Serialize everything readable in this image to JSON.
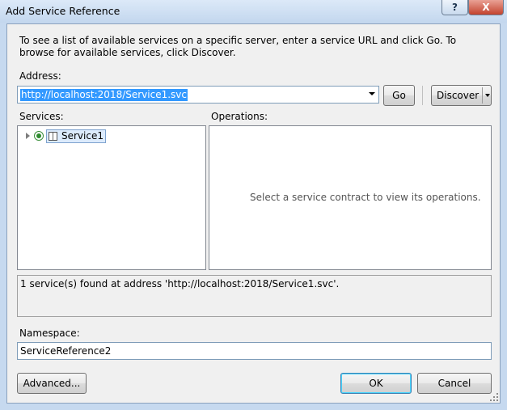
{
  "window": {
    "title": "Add Service Reference",
    "help_glyph": "?",
    "close_glyph": "X"
  },
  "instructions": "To see a list of available services on a specific server, enter a service URL and click Go. To browse for available services, click Discover.",
  "address": {
    "label": "Address:",
    "value": "http://localhost:2018/Service1.svc"
  },
  "buttons": {
    "go": "Go",
    "discover": "Discover",
    "advanced": "Advanced...",
    "ok": "OK",
    "cancel": "Cancel"
  },
  "services": {
    "label": "Services:",
    "items": [
      {
        "name": "Service1",
        "icon": "service-icon",
        "expanded": false
      }
    ]
  },
  "operations": {
    "label": "Operations:",
    "empty_message": "Select a service contract to view its operations."
  },
  "status": "1 service(s) found at address 'http://localhost:2018/Service1.svc'.",
  "namespace": {
    "label": "Namespace:",
    "value": "ServiceReference2"
  },
  "colors": {
    "selection": "#3399ff",
    "title_bar": "#c6d9ef",
    "close_button": "#c3432e"
  }
}
